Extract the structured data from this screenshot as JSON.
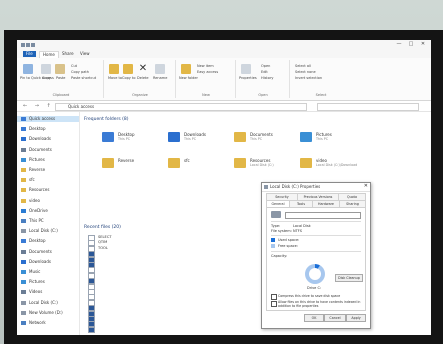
{
  "window": {
    "title": "",
    "controls": [
      "—",
      "□",
      "✕"
    ]
  },
  "ribbon": {
    "tabs": [
      "File",
      "Home",
      "Share",
      "View"
    ],
    "groups": [
      {
        "label": "Clipboard",
        "buttons": [
          "Pin to Quick access",
          "Copy",
          "Paste"
        ],
        "small": [
          "Cut",
          "Copy path",
          "Paste shortcut"
        ]
      },
      {
        "label": "Organize",
        "buttons": [
          "Move to",
          "Copy to",
          "Delete",
          "Rename"
        ]
      },
      {
        "label": "New",
        "buttons": [
          "New folder"
        ],
        "small": [
          "New item",
          "Easy access"
        ]
      },
      {
        "label": "Open",
        "buttons": [
          "Properties"
        ],
        "small": [
          "Open",
          "Edit",
          "History"
        ]
      },
      {
        "label": "Select",
        "small": [
          "Select all",
          "Select none",
          "Invert selection"
        ]
      }
    ]
  },
  "address": {
    "path": "Quick access",
    "search_placeholder": ""
  },
  "sidebar": {
    "items": [
      {
        "label": "Quick access",
        "color": "#3a7bd5",
        "selected": true
      },
      {
        "label": "Desktop",
        "color": "#3a7bd5"
      },
      {
        "label": "Downloads",
        "color": "#2b6fcf"
      },
      {
        "label": "Documents",
        "color": "#6b7d95"
      },
      {
        "label": "Pictures",
        "color": "#3a8fd5"
      },
      {
        "label": "Reverse",
        "color": "#e2b746"
      },
      {
        "label": "sfc",
        "color": "#e2b746"
      },
      {
        "label": "Resources",
        "color": "#e2b746"
      },
      {
        "label": "video",
        "color": "#e2b746"
      },
      {
        "label": "OneDrive",
        "color": "#2b7cd3"
      },
      {
        "label": "This PC",
        "color": "#4a7fc1"
      },
      {
        "label": "Local Disk (C:)",
        "color": "#8a96a6"
      },
      {
        "label": "Desktop",
        "color": "#3a7bd5"
      },
      {
        "label": "Documents",
        "color": "#6b7d95"
      },
      {
        "label": "Downloads",
        "color": "#2b6fcf"
      },
      {
        "label": "Music",
        "color": "#3a8fd5"
      },
      {
        "label": "Pictures",
        "color": "#3a8fd5"
      },
      {
        "label": "Videos",
        "color": "#6b7d95"
      },
      {
        "label": "Local Disk (C:)",
        "color": "#8a96a6"
      },
      {
        "label": "New Volume (D:)",
        "color": "#8a96a6"
      },
      {
        "label": "Network",
        "color": "#4a7fc1"
      }
    ]
  },
  "frequent": {
    "heading": "Frequent folders (8)",
    "items": [
      {
        "name": "Desktop",
        "sub": "This PC",
        "color": "#3a7bd5"
      },
      {
        "name": "Downloads",
        "sub": "This PC",
        "color": "#2b6fcf"
      },
      {
        "name": "Documents",
        "sub": "This PC",
        "color": "#e2b746"
      },
      {
        "name": "Pictures",
        "sub": "This PC",
        "color": "#3a8fd5"
      },
      {
        "name": "Reverse",
        "sub": "",
        "color": "#e2b746"
      },
      {
        "name": "sfc",
        "sub": "",
        "color": "#e2b746"
      },
      {
        "name": "Resources",
        "sub": "Local Disk (C:)",
        "color": "#e2b746"
      },
      {
        "name": "video",
        "sub": "Local Disk (C:)\\Download",
        "color": "#e2b746"
      }
    ]
  },
  "recent": {
    "heading": "Recent files (20)",
    "items": [
      {
        "name": "SELECT",
        "loc": "",
        "color": "#ffffff"
      },
      {
        "name": "QTIM",
        "loc": "",
        "color": "#ffffff"
      },
      {
        "name": "TOOL",
        "loc": "",
        "color": "#ffffff"
      },
      {
        "name": "",
        "loc": "",
        "color": "#2b5797"
      },
      {
        "name": "",
        "loc": "",
        "color": "#2b5797"
      },
      {
        "name": "",
        "loc": "",
        "color": "#2b5797"
      },
      {
        "name": "",
        "loc": "",
        "color": "#ffffff"
      },
      {
        "name": "",
        "loc": "",
        "color": "#ffffff"
      },
      {
        "name": "",
        "loc": "",
        "color": "#2b5797"
      },
      {
        "name": "",
        "loc": "",
        "color": "#ffffff"
      },
      {
        "name": "",
        "loc": "",
        "color": "#ffffff"
      },
      {
        "name": "",
        "loc": "",
        "color": "#ffffff"
      },
      {
        "name": "",
        "loc": "",
        "color": "#ffffff"
      },
      {
        "name": "",
        "loc": "",
        "color": "#2b5797"
      },
      {
        "name": "",
        "loc": "",
        "color": "#2b5797"
      },
      {
        "name": "",
        "loc": "",
        "color": "#2b5797"
      },
      {
        "name": "",
        "loc": "",
        "color": "#2b5797"
      },
      {
        "name": "",
        "loc": "",
        "color": "#2b5797"
      }
    ]
  },
  "dialog": {
    "title": "Local Disk (C:) Properties",
    "tabs_top": [
      "Security",
      "Previous Versions",
      "Quota"
    ],
    "tabs_bottom": [
      "General",
      "Tools",
      "Hardware",
      "Sharing"
    ],
    "name_value": "",
    "type_label": "Type:",
    "type_value": "Local Disk",
    "fs_label": "File system:",
    "fs_value": "NTFS",
    "used_label": "Used space:",
    "used_bytes": "",
    "used_gb": "",
    "free_label": "Free space:",
    "free_bytes": "",
    "free_gb": "",
    "cap_label": "Capacity:",
    "cap_bytes": "",
    "cap_gb": "",
    "drive_label": "Drive C:",
    "cleanup_label": "Disk Cleanup",
    "used_fraction": 0.08,
    "used_color": "#1a6fd8",
    "free_color": "#a7c7ee",
    "compress_label": "Compress this drive to save disk space",
    "index_label": "Allow files on this drive to have contents indexed in addition to file properties",
    "buttons": [
      "OK",
      "Cancel",
      "Apply"
    ]
  }
}
